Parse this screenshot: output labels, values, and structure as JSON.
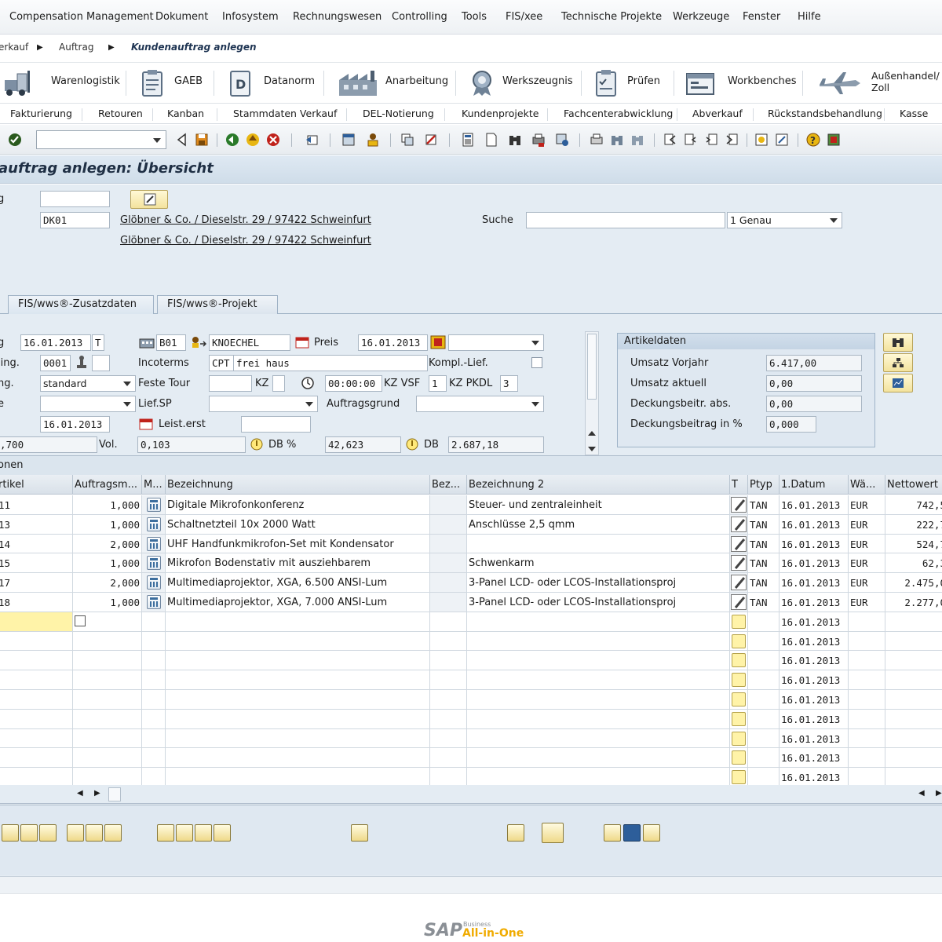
{
  "menu": [
    "Compensation Management",
    "Dokument",
    "Infosystem",
    "Rechnungswesen",
    "Controlling",
    "Tools",
    "FIS/xee",
    "Technische Projekte",
    "Werkzeuge",
    "Fenster",
    "Hilfe"
  ],
  "breadcrumb": {
    "items": [
      "erkauf",
      "Auftrag",
      "Kundenauftrag anlegen"
    ]
  },
  "launchpad": [
    "Warenlogistik",
    "GAEB",
    "Datanorm",
    "Anarbeitung",
    "Werkszeugnis",
    "Prüfen",
    "Workbenches",
    "Außenhandel/\nZoll"
  ],
  "functions": [
    "Fakturierung",
    "Retouren",
    "Kanban",
    "Stammdaten Verkauf",
    "DEL-Notierung",
    "Kundenprojekte",
    "Fachcenterabwicklung",
    "Abverkauf",
    "Rückstandsbehandlung",
    "Kasse"
  ],
  "title": "auftrag anlegen: Übersicht",
  "header": {
    "label_1": "g",
    "customer_code": "DK01",
    "address_1": "Glöbner & Co. / Dieselstr. 29 / 97422 Schweinfurt",
    "address_2": "Glöbner & Co. / Dieselstr. 29 / 97422 Schweinfurt",
    "search_label": "Suche",
    "search_mode": "1 Genau"
  },
  "tabs": [
    "FIS/wws®-Zusatzdaten",
    "FIS/wws®-Projekt"
  ],
  "form": {
    "r1_label": "g",
    "r1_date": "16.01.2013",
    "r1_t": "T",
    "r1_code": "B01",
    "r1_user": "KNOECHEL",
    "r1_preis_label": "Preis",
    "r1_preis_date": "16.01.2013",
    "r2_label": "ling.",
    "r2_val": "0001",
    "r2_incoterms_label": "Incoterms",
    "r2_incoterms": "CPT",
    "r2_incoterms_text": "frei haus",
    "r2_kompl_label": "Kompl.-Lief.",
    "r3_label": "ng.",
    "r3_val": "standard",
    "r3_tour_label": "Feste Tour",
    "r3_kz_label": "KZ",
    "r3_time": "00:00:00",
    "r3_vsf_label": "KZ VSF",
    "r3_vsf": "1",
    "r3_pkdl_label": "KZ PKDL",
    "r3_pkdl": "3",
    "r4_label": "e",
    "r4_liefsp_label": "Lief.SP",
    "r4_grund_label": "Auftragsgrund",
    "r5_date": "16.01.2013",
    "r5_leist_label": "Leist.erst",
    "r6_val": ",700",
    "r6_vol_label": "Vol.",
    "r6_vol": "0,103",
    "r6_dbp_label": "DB %",
    "r6_dbp": "42,623",
    "r6_db_label": "DB",
    "r6_db": "2.687,18"
  },
  "artikeldaten": {
    "title": "Artikeldaten",
    "rows": [
      {
        "label": "Umsatz Vorjahr",
        "value": "6.417,00"
      },
      {
        "label": "Umsatz aktuell",
        "value": "0,00"
      },
      {
        "label": "Deckungsbeitr. abs.",
        "value": "0,00"
      },
      {
        "label": "Deckungsbeitrag in %",
        "value": "0,000"
      }
    ]
  },
  "section_label": "onen",
  "table": {
    "columns": [
      "rtikel",
      "Auftragsm...",
      "M...",
      "Bezeichnung",
      "Bez...",
      "Bezeichnung 2",
      "T",
      "Ptyp",
      "1.Datum",
      "Wä...",
      "Nettowert"
    ],
    "rows": [
      {
        "artikel": "11",
        "menge": "1,000",
        "bez": "Digitale Mikrofonkonferenz",
        "bez2": "Steuer- und zentraleinheit",
        "ptyp": "TAN",
        "datum": "16.01.2013",
        "waehrung": "EUR",
        "netto": "742,5"
      },
      {
        "artikel": "13",
        "menge": "1,000",
        "bez": "Schaltnetzteil 10x 2000 Watt",
        "bez2": "Anschlüsse 2,5 qmm",
        "ptyp": "TAN",
        "datum": "16.01.2013",
        "waehrung": "EUR",
        "netto": "222,7"
      },
      {
        "artikel": "14",
        "menge": "2,000",
        "bez": "UHF Handfunkmikrofon-Set mit Kondensator",
        "bez2": "",
        "ptyp": "TAN",
        "datum": "16.01.2013",
        "waehrung": "EUR",
        "netto": "524,7"
      },
      {
        "artikel": "15",
        "menge": "1,000",
        "bez": "Mikrofon Bodenstativ mit ausziehbarem",
        "bez2": "Schwenkarm",
        "ptyp": "TAN",
        "datum": "16.01.2013",
        "waehrung": "EUR",
        "netto": "62,3"
      },
      {
        "artikel": "17",
        "menge": "2,000",
        "bez": "Multimediaprojektor, XGA, 6.500 ANSI-Lum",
        "bez2": "3-Panel LCD- oder LCOS-Installationsproj",
        "ptyp": "TAN",
        "datum": "16.01.2013",
        "waehrung": "EUR",
        "netto": "2.475,0"
      },
      {
        "artikel": "18",
        "menge": "1,000",
        "bez": "Multimediaprojektor, XGA, 7.000 ANSI-Lum",
        "bez2": "3-Panel LCD- oder LCOS-Installationsproj",
        "ptyp": "TAN",
        "datum": "16.01.2013",
        "waehrung": "EUR",
        "netto": "2.277,0"
      }
    ],
    "empty_dates": [
      "16.01.2013",
      "16.01.2013",
      "16.01.2013",
      "16.01.2013",
      "16.01.2013",
      "16.01.2013",
      "16.01.2013",
      "16.01.2013",
      "16.01.2013"
    ]
  },
  "brand": {
    "sap": "SAP",
    "business": "Business",
    "product": "All-in-One"
  },
  "colors": {
    "accent": "#f0ab00",
    "title_bg": "#cfdde9",
    "content_bg": "#e4ecf3"
  }
}
